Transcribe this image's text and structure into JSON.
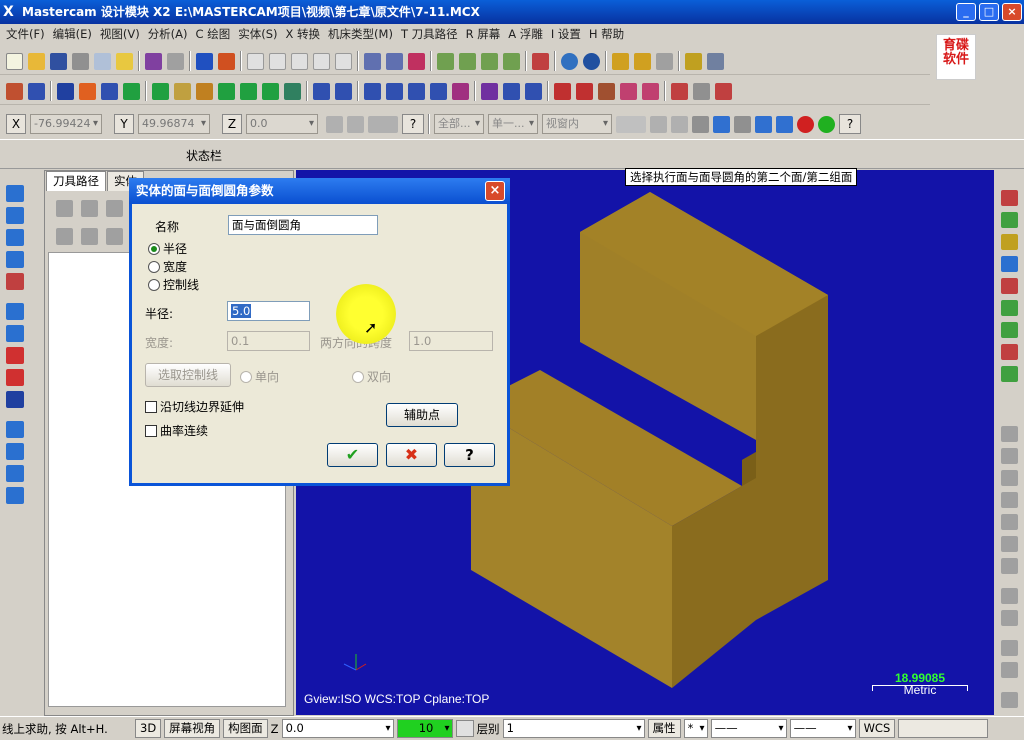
{
  "app": {
    "title": "Mastercam 设计模块  X2  E:\\MASTERCAM项目\\视频\\第七章\\原文件\\7-11.MCX",
    "window_buttons": [
      "_",
      "□",
      "×"
    ]
  },
  "menu": [
    "文件(F)",
    "编辑(E)",
    "视图(V)",
    "分析(A)",
    "C 绘图",
    "实体(S)",
    "X 转换",
    "机床类型(M)",
    "T 刀具路径",
    "R 屏幕",
    "A 浮雕",
    "I 设置",
    "H 帮助"
  ],
  "logo": {
    "line1": "育碟",
    "line2": "软件",
    "color": "#d81818"
  },
  "coordbar": {
    "x_label": "X",
    "x_value": "-76.99424",
    "y_label": "Y",
    "y_value": "49.96874",
    "z_label": "Z",
    "z_value": "0.0",
    "all_button": "全部...",
    "single_button": "单一...",
    "view_select": "视窗内"
  },
  "status_label": "状态栏",
  "manager": {
    "tab1": "刀具路径",
    "tab2": "实体"
  },
  "viewport": {
    "prompt": "选择执行面与面导圆角的第二个面/第二组面",
    "info": "Gview:ISO   WCS:TOP   Cplane:TOP",
    "scale_value": "18.99085",
    "scale_unit": "Metric",
    "background": "#1313a8",
    "solid_color": "#a8862e"
  },
  "dialog": {
    "title": "实体的面与面倒圆角参数",
    "close": "×",
    "name_label": "名称",
    "name_value": "面与面倒圆角",
    "radio_radius": "半径",
    "radio_width": "宽度",
    "radio_control": "控制线",
    "selected_radio": "半径",
    "radius_label": "半径:",
    "radius_value": "5.0",
    "width_label": "宽度:",
    "width_value": "0.1",
    "ratio_label": "两方向的跨度",
    "ratio_value": "1.0",
    "pick_control_button": "选取控制线",
    "single_dir": "单向",
    "double_dir": "双向",
    "check_extend": "沿切线边界延伸",
    "check_curvature": "曲率连续",
    "aux_point_button": "辅助点",
    "ok": "✔",
    "cancel": "✖",
    "help": "?"
  },
  "bottombar": {
    "help_text": "线上求助, 按 Alt+H.",
    "btn_3d": "3D",
    "btn_screen_view": "屏幕视角",
    "btn_plane": "构图面",
    "z_label": "Z",
    "z_value": "0.0",
    "level_color_value": "10",
    "level_label": "层别",
    "level_value": "1",
    "attr_label": "属性",
    "wcs_label": "WCS"
  }
}
